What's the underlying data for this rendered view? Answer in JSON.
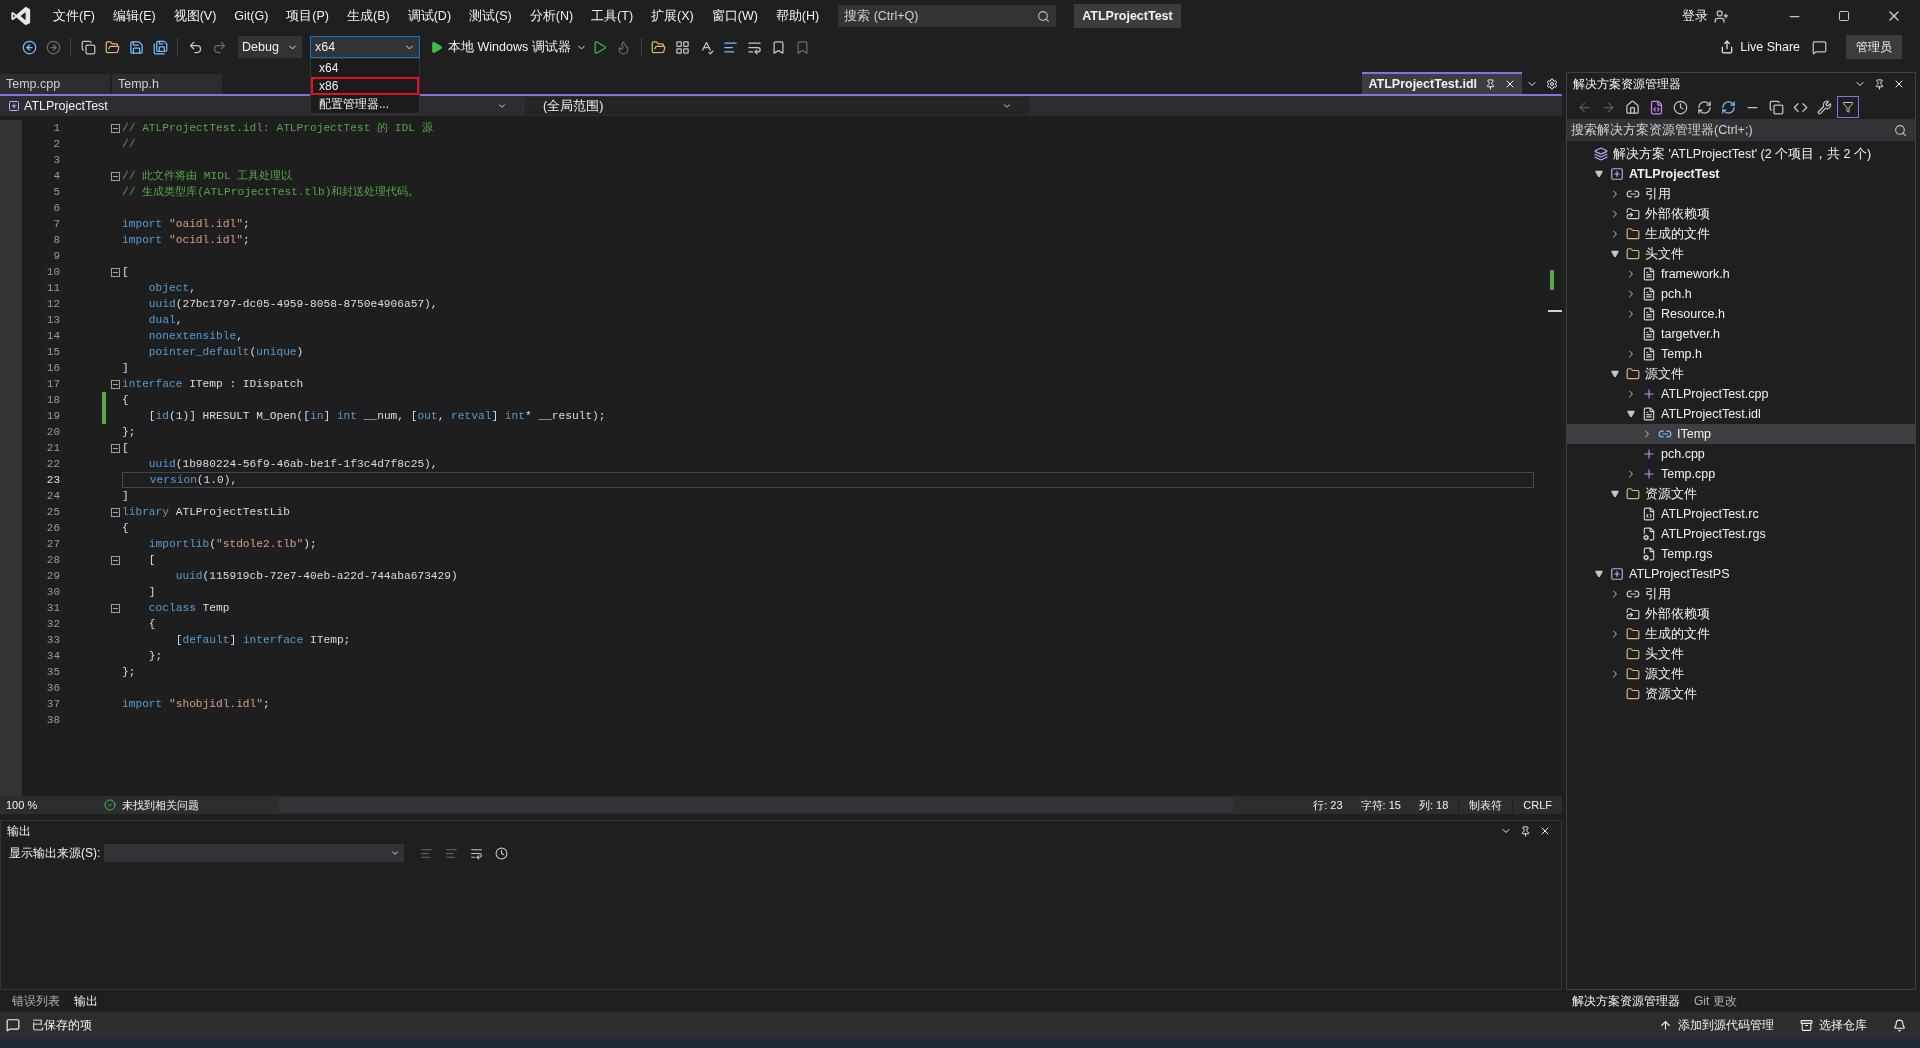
{
  "title_bar": {
    "menus": [
      "文件(F)",
      "编辑(E)",
      "视图(V)",
      "Git(G)",
      "项目(P)",
      "生成(B)",
      "调试(D)",
      "测试(S)",
      "分析(N)",
      "工具(T)",
      "扩展(X)",
      "窗口(W)",
      "帮助(H)"
    ],
    "search": {
      "placeholder": "搜索 (Ctrl+Q)"
    },
    "title": "ATLProjectTest",
    "sign_in": "登录"
  },
  "toolbar": {
    "configuration": "Debug",
    "platform": "x64",
    "debugger": "本地 Windows 调试器",
    "live_share": "Live Share",
    "admin": "管理员",
    "platform_menu": [
      {
        "label": "x64",
        "selected": false
      },
      {
        "label": "x86",
        "selected": true
      },
      {
        "label": "配置管理器...",
        "selected": false
      }
    ]
  },
  "document_tabs": [
    {
      "label": "Temp.cpp",
      "selected": false
    },
    {
      "label": "Temp.h",
      "selected": false
    },
    {
      "label": "ATLProjectTest.idl",
      "selected": true
    }
  ],
  "nav_bar": {
    "project": "ATLProjectTest",
    "scope": "(全局范围)"
  },
  "editor": {
    "lines": [
      {
        "n": "1",
        "fold": true,
        "changed": false,
        "current": false,
        "code": [
          {
            "kind": "comment",
            "text": "// ATLProjectTest.idl: ATLProjectTest 的 IDL 源"
          }
        ]
      },
      {
        "n": "2",
        "fold": false,
        "changed": false,
        "current": false,
        "code": [
          {
            "kind": "comment",
            "text": "//"
          }
        ]
      },
      {
        "n": "3",
        "fold": false,
        "changed": false,
        "current": false
      },
      {
        "n": "4",
        "fold": true,
        "changed": false,
        "current": false,
        "code": [
          {
            "kind": "comment",
            "text": "// 此文件将由 MIDL 工具处理以"
          }
        ]
      },
      {
        "n": "5",
        "fold": false,
        "changed": false,
        "current": false,
        "code": [
          {
            "kind": "comment",
            "text": "// 生成类型库(ATLProjectTest.tlb)和封送处理代码。"
          }
        ]
      },
      {
        "n": "6",
        "fold": false,
        "changed": false,
        "current": false
      },
      {
        "n": "7",
        "fold": false,
        "changed": false,
        "current": false,
        "code": [
          {
            "kind": "keyword",
            "text": "import"
          },
          {
            "kind": "string",
            "text": " \"oaidl.idl\""
          },
          {
            "kind": "plain",
            "text": ";"
          }
        ]
      },
      {
        "n": "8",
        "fold": false,
        "changed": false,
        "current": false,
        "code": [
          {
            "kind": "keyword",
            "text": "import"
          },
          {
            "kind": "string",
            "text": " \"ocidl.idl\""
          },
          {
            "kind": "plain",
            "text": ";"
          }
        ]
      },
      {
        "n": "9",
        "fold": false,
        "changed": false,
        "current": false
      },
      {
        "n": "10",
        "fold": true,
        "changed": false,
        "current": false,
        "code": [
          {
            "kind": "plain",
            "text": "["
          }
        ]
      },
      {
        "n": "11",
        "fold": false,
        "changed": false,
        "current": false,
        "code": [
          {
            "kind": "keyword",
            "text": "    object"
          },
          {
            "kind": "plain",
            "text": ","
          }
        ]
      },
      {
        "n": "12",
        "fold": false,
        "changed": false,
        "current": false,
        "code": [
          {
            "kind": "keyword",
            "text": "    uuid"
          },
          {
            "kind": "plain",
            "text": "(27bc1797-dc05-4959-8058-8750e4906a57),"
          }
        ]
      },
      {
        "n": "13",
        "fold": false,
        "changed": false,
        "current": false,
        "code": [
          {
            "kind": "keyword",
            "text": "    dual"
          },
          {
            "kind": "plain",
            "text": ","
          }
        ]
      },
      {
        "n": "14",
        "fold": false,
        "changed": false,
        "current": false,
        "code": [
          {
            "kind": "keyword",
            "text": "    nonextensible"
          },
          {
            "kind": "plain",
            "text": ","
          }
        ]
      },
      {
        "n": "15",
        "fold": false,
        "changed": false,
        "current": false,
        "code": [
          {
            "kind": "keyword",
            "text": "    pointer_default"
          },
          {
            "kind": "plain",
            "text": "("
          },
          {
            "kind": "keyword",
            "text": "unique"
          },
          {
            "kind": "plain",
            "text": ")"
          }
        ]
      },
      {
        "n": "16",
        "fold": false,
        "changed": false,
        "current": false,
        "code": [
          {
            "kind": "plain",
            "text": "]"
          }
        ]
      },
      {
        "n": "17",
        "fold": true,
        "changed": false,
        "current": false,
        "code": [
          {
            "kind": "keyword",
            "text": "interface"
          },
          {
            "kind": "plain",
            "text": " ITemp : IDispatch"
          }
        ]
      },
      {
        "n": "18",
        "fold": false,
        "changed": true,
        "current": false,
        "code": [
          {
            "kind": "plain",
            "text": "{"
          }
        ]
      },
      {
        "n": "19",
        "fold": false,
        "changed": true,
        "current": false,
        "code": [
          {
            "kind": "plain",
            "text": "    ["
          },
          {
            "kind": "keyword",
            "text": "id"
          },
          {
            "kind": "plain",
            "text": "(1)] HRESULT M_Open(["
          },
          {
            "kind": "keyword",
            "text": "in"
          },
          {
            "kind": "plain",
            "text": "] "
          },
          {
            "kind": "keyword",
            "text": "int"
          },
          {
            "kind": "plain",
            "text": " __num, ["
          },
          {
            "kind": "keyword",
            "text": "out"
          },
          {
            "kind": "plain",
            "text": ", "
          },
          {
            "kind": "keyword",
            "text": "retval"
          },
          {
            "kind": "plain",
            "text": "] "
          },
          {
            "kind": "keyword",
            "text": "int"
          },
          {
            "kind": "plain",
            "text": "* __result);"
          }
        ]
      },
      {
        "n": "20",
        "fold": false,
        "changed": false,
        "current": false,
        "code": [
          {
            "kind": "plain",
            "text": "};"
          }
        ]
      },
      {
        "n": "21",
        "fold": true,
        "changed": false,
        "current": false,
        "code": [
          {
            "kind": "plain",
            "text": "["
          }
        ]
      },
      {
        "n": "22",
        "fold": false,
        "changed": false,
        "current": false,
        "code": [
          {
            "kind": "keyword",
            "text": "    uuid"
          },
          {
            "kind": "plain",
            "text": "(1b980224-56f9-46ab-be1f-1f3c4d7f8c25),"
          }
        ]
      },
      {
        "n": "23",
        "fold": false,
        "changed": false,
        "current": true,
        "code": [
          {
            "kind": "keyword",
            "text": "    version"
          },
          {
            "kind": "plain",
            "text": "(1.0),"
          }
        ]
      },
      {
        "n": "24",
        "fold": false,
        "changed": false,
        "current": false,
        "code": [
          {
            "kind": "plain",
            "text": "]"
          }
        ]
      },
      {
        "n": "25",
        "fold": true,
        "changed": false,
        "current": false,
        "code": [
          {
            "kind": "keyword",
            "text": "library"
          },
          {
            "kind": "plain",
            "text": " ATLProjectTestLib"
          }
        ]
      },
      {
        "n": "26",
        "fold": false,
        "changed": false,
        "current": false,
        "code": [
          {
            "kind": "plain",
            "text": "{"
          }
        ]
      },
      {
        "n": "27",
        "fold": false,
        "changed": false,
        "current": false,
        "code": [
          {
            "kind": "keyword",
            "text": "    importlib"
          },
          {
            "kind": "plain",
            "text": "("
          },
          {
            "kind": "string",
            "text": "\"stdole2.tlb\""
          },
          {
            "kind": "plain",
            "text": ");"
          }
        ]
      },
      {
        "n": "28",
        "fold": true,
        "changed": false,
        "current": false,
        "code": [
          {
            "kind": "plain",
            "text": "    ["
          }
        ]
      },
      {
        "n": "29",
        "fold": false,
        "changed": false,
        "current": false,
        "code": [
          {
            "kind": "keyword",
            "text": "        uuid"
          },
          {
            "kind": "plain",
            "text": "(115919cb-72e7-40eb-a22d-744aba673429)"
          }
        ]
      },
      {
        "n": "30",
        "fold": false,
        "changed": false,
        "current": false,
        "code": [
          {
            "kind": "plain",
            "text": "    ]"
          }
        ]
      },
      {
        "n": "31",
        "fold": true,
        "changed": false,
        "current": false,
        "code": [
          {
            "kind": "keyword",
            "text": "    coclass"
          },
          {
            "kind": "plain",
            "text": " Temp"
          }
        ]
      },
      {
        "n": "32",
        "fold": false,
        "changed": false,
        "current": false,
        "code": [
          {
            "kind": "plain",
            "text": "    {"
          }
        ]
      },
      {
        "n": "33",
        "fold": false,
        "changed": false,
        "current": false,
        "code": [
          {
            "kind": "plain",
            "text": "        ["
          },
          {
            "kind": "keyword",
            "text": "default"
          },
          {
            "kind": "plain",
            "text": "] "
          },
          {
            "kind": "keyword",
            "text": "interface"
          },
          {
            "kind": "plain",
            "text": " ITemp;"
          }
        ]
      },
      {
        "n": "34",
        "fold": false,
        "changed": false,
        "current": false,
        "code": [
          {
            "kind": "plain",
            "text": "    };"
          }
        ]
      },
      {
        "n": "35",
        "fold": false,
        "changed": false,
        "current": false,
        "code": [
          {
            "kind": "plain",
            "text": "};"
          }
        ]
      },
      {
        "n": "36",
        "fold": false,
        "changed": false,
        "current": false
      },
      {
        "n": "37",
        "fold": false,
        "changed": false,
        "current": false,
        "code": [
          {
            "kind": "keyword",
            "text": "import"
          },
          {
            "kind": "string",
            "text": " \"shobjidl.idl\""
          },
          {
            "kind": "plain",
            "text": ";"
          }
        ]
      },
      {
        "n": "38",
        "fold": false,
        "changed": false,
        "current": false
      }
    ]
  },
  "editor_status": {
    "zoom": "100 %",
    "issues": "未找到相关问题",
    "line": "行: 23",
    "char": "字符: 15",
    "col": "列: 18",
    "indent": "制表符",
    "eol": "CRLF"
  },
  "output_panel": {
    "title": "输出",
    "source_label": "显示输出来源(S):"
  },
  "bottom_tabs": [
    {
      "label": "错误列表",
      "selected": false
    },
    {
      "label": "输出",
      "selected": true
    }
  ],
  "solution_explorer": {
    "title": "解决方案资源管理器",
    "search": {
      "placeholder": "搜索解决方案资源管理器(Ctrl+;)"
    },
    "tree": [
      {
        "label": "解决方案 'ATLProjectTest' (2 个项目，共 2 个)",
        "kind": "solution",
        "selected": false,
        "children": [
          {
            "label": "ATLProjectTest",
            "kind": "project",
            "bold": true,
            "expanded": true,
            "selected": false,
            "children": [
              {
                "label": "引用",
                "kind": "reference",
                "expanded": false,
                "selected": false
              },
              {
                "label": "外部依赖项",
                "kind": "external",
                "expanded": false,
                "selected": false
              },
              {
                "label": "生成的文件",
                "kind": "filter",
                "expanded": false,
                "selected": false
              },
              {
                "label": "头文件",
                "kind": "filter",
                "expanded": true,
                "selected": false,
                "children": [
                  {
                    "label": "framework.h",
                    "kind": "header",
                    "expanded": false,
                    "selected": false
                  },
                  {
                    "label": "pch.h",
                    "kind": "header",
                    "expanded": false,
                    "selected": false
                  },
                  {
                    "label": "Resource.h",
                    "kind": "header",
                    "expanded": false,
                    "selected": false
                  },
                  {
                    "label": "targetver.h",
                    "kind": "header",
                    "selected": false
                  },
                  {
                    "label": "Temp.h",
                    "kind": "header",
                    "expanded": false,
                    "selected": false
                  }
                ]
              },
              {
                "label": "源文件",
                "kind": "filter",
                "expanded": true,
                "selected": false,
                "children": [
                  {
                    "label": "ATLProjectTest.cpp",
                    "kind": "cpp",
                    "expanded": false,
                    "selected": false
                  },
                  {
                    "label": "ATLProjectTest.idl",
                    "kind": "idl",
                    "expanded": true,
                    "selected": false,
                    "children": [
                      {
                        "label": "ITemp",
                        "kind": "interface",
                        "expanded": false,
                        "selected": true
                      }
                    ]
                  },
                  {
                    "label": "pch.cpp",
                    "kind": "cpp",
                    "selected": false
                  },
                  {
                    "label": "Temp.cpp",
                    "kind": "cpp",
                    "expanded": false,
                    "selected": false
                  }
                ]
              },
              {
                "label": "资源文件",
                "kind": "filter",
                "expanded": true,
                "selected": false,
                "children": [
                  {
                    "label": "ATLProjectTest.rc",
                    "kind": "rc",
                    "selected": false
                  },
                  {
                    "label": "ATLProjectTest.rgs",
                    "kind": "rgs",
                    "selected": false
                  },
                  {
                    "label": "Temp.rgs",
                    "kind": "rgs",
                    "selected": false
                  }
                ]
              }
            ]
          },
          {
            "label": "ATLProjectTestPS",
            "kind": "project",
            "bold": false,
            "expanded": true,
            "selected": false,
            "children": [
              {
                "label": "引用",
                "kind": "reference",
                "expanded": false,
                "selected": false
              },
              {
                "label": "外部依赖项",
                "kind": "external",
                "selected": false
              },
              {
                "label": "生成的文件",
                "kind": "filter",
                "expanded": false,
                "selected": false
              },
              {
                "label": "头文件",
                "kind": "filter",
                "selected": false
              },
              {
                "label": "源文件",
                "kind": "filter",
                "expanded": false,
                "selected": false
              },
              {
                "label": "资源文件",
                "kind": "filter",
                "selected": false
              }
            ]
          }
        ]
      }
    ],
    "tabs": [
      {
        "label": "解决方案资源管理器",
        "selected": true
      },
      {
        "label": "Git 更改",
        "selected": false
      }
    ]
  },
  "status_bar": {
    "saved": "已保存的项",
    "source_control": "添加到源代码管理",
    "repo": "选择仓库"
  }
}
